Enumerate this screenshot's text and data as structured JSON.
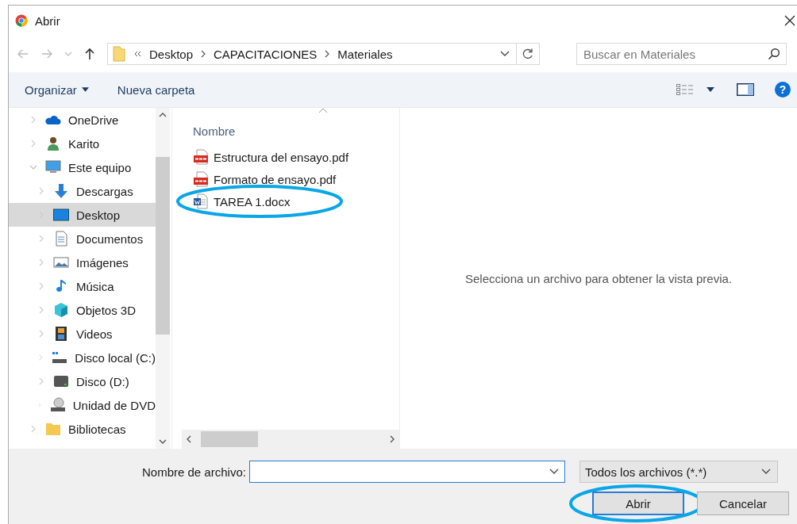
{
  "window": {
    "title": "Abrir"
  },
  "navigation": {
    "path": [
      "Desktop",
      "CAPACITACIONES",
      "Materiales"
    ],
    "search": {
      "placeholder": "Buscar en Materiales"
    }
  },
  "toolbar": {
    "organize": "Organizar",
    "new_folder": "Nueva carpeta",
    "help": "?"
  },
  "sidebar": {
    "items": [
      {
        "label": "OneDrive",
        "kind": "cloud",
        "expanded": false,
        "selected": false
      },
      {
        "label": "Karito",
        "kind": "user",
        "expanded": false,
        "selected": false
      },
      {
        "label": "Este equipo",
        "kind": "computer",
        "expanded": true,
        "selected": false,
        "children": [
          {
            "label": "Descargas",
            "kind": "download",
            "expanded": false,
            "selected": false
          },
          {
            "label": "Desktop",
            "kind": "desktop",
            "expanded": false,
            "selected": true
          },
          {
            "label": "Documentos",
            "kind": "documents",
            "expanded": false,
            "selected": false
          },
          {
            "label": "Imágenes",
            "kind": "pictures",
            "expanded": false,
            "selected": false
          },
          {
            "label": "Música",
            "kind": "music",
            "expanded": false,
            "selected": false
          },
          {
            "label": "Objetos 3D",
            "kind": "objects3d",
            "expanded": false,
            "selected": false
          },
          {
            "label": "Videos",
            "kind": "videos",
            "expanded": false,
            "selected": false
          },
          {
            "label": "Disco local (C:)",
            "kind": "system-drive",
            "expanded": false,
            "selected": false
          },
          {
            "label": "Disco (D:)",
            "kind": "drive",
            "expanded": false,
            "selected": false
          },
          {
            "label": "Unidad de DVD",
            "kind": "dvd",
            "expanded": false,
            "selected": false
          }
        ]
      },
      {
        "label": "Bibliotecas",
        "kind": "folder",
        "expanded": false,
        "selected": false
      }
    ]
  },
  "file_list": {
    "column": "Nombre",
    "files": [
      {
        "name": "Estructura del ensayo.pdf",
        "kind": "pdf",
        "highlighted": false
      },
      {
        "name": "Formato de ensayo.pdf",
        "kind": "pdf",
        "highlighted": false
      },
      {
        "name": "TAREA 1.docx",
        "kind": "word",
        "highlighted": true
      }
    ]
  },
  "preview": {
    "message": "Selecciona un archivo para obtener la vista previa."
  },
  "footer": {
    "filename_label": "Nombre de archivo:",
    "filter": "Todos los archivos (*.*)",
    "buttons": [
      {
        "label": "Abrir",
        "default": true,
        "highlighted": true
      },
      {
        "label": "Cancelar",
        "default": false,
        "highlighted": false
      }
    ]
  }
}
